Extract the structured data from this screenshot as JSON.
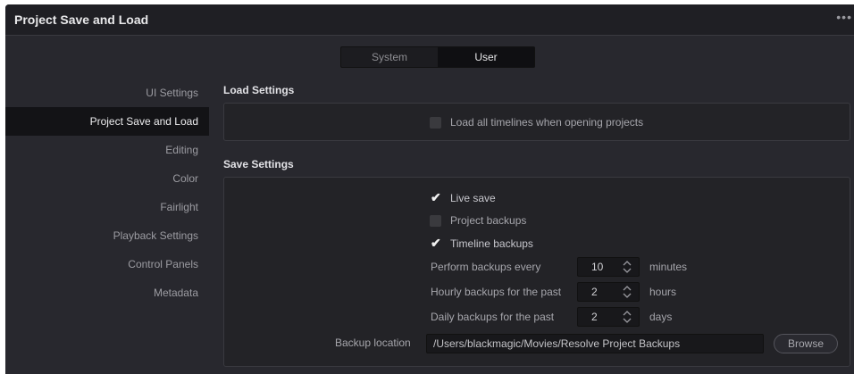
{
  "window": {
    "title": "Project Save and Load",
    "more_icon": "ellipsis-icon"
  },
  "segmented": {
    "tabs": [
      "System",
      "User"
    ],
    "active": "User"
  },
  "sidebar": {
    "items": [
      {
        "label": "UI Settings"
      },
      {
        "label": "Project Save and Load"
      },
      {
        "label": "Editing"
      },
      {
        "label": "Color"
      },
      {
        "label": "Fairlight"
      },
      {
        "label": "Playback Settings"
      },
      {
        "label": "Control Panels"
      },
      {
        "label": "Metadata"
      }
    ],
    "active": "Project Save and Load"
  },
  "load_settings": {
    "title": "Load Settings",
    "load_all_timelines": {
      "label": "Load all timelines when opening projects",
      "checked": false
    }
  },
  "save_settings": {
    "title": "Save Settings",
    "live_save": {
      "label": "Live save",
      "checked": true
    },
    "project_backups": {
      "label": "Project backups",
      "checked": false
    },
    "timeline_backups": {
      "label": "Timeline backups",
      "checked": true
    },
    "perform_every": {
      "label": "Perform backups every",
      "value": "10",
      "unit": "minutes"
    },
    "hourly": {
      "label": "Hourly backups for the past",
      "value": "2",
      "unit": "hours"
    },
    "daily": {
      "label": "Daily backups for the past",
      "value": "2",
      "unit": "days"
    },
    "backup_location": {
      "label": "Backup location",
      "value": "/Users/blackmagic/Movies/Resolve Project Backups",
      "browse_label": "Browse"
    }
  },
  "colors": {
    "background": "#28282e",
    "titlebar": "#1f1f24",
    "panel": "#232327",
    "active_item": "#131316"
  }
}
